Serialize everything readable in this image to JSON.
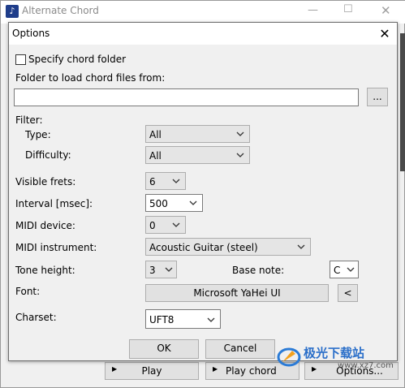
{
  "parent_window": {
    "title": "Alternate Chord",
    "buttons": {
      "play": "Play",
      "play_chord": "Play chord",
      "options": "Options..."
    }
  },
  "dialog": {
    "title": "Options",
    "specify_folder": {
      "label": "Specify chord folder",
      "checked": false
    },
    "folder_label": "Folder to load chord files from:",
    "folder_value": "",
    "browse_label": "...",
    "filter_label": "Filter:",
    "type": {
      "label": "Type:",
      "value": "All"
    },
    "difficulty": {
      "label": "Difficulty:",
      "value": "All"
    },
    "visible_frets": {
      "label": "Visible frets:",
      "value": "6"
    },
    "interval": {
      "label": "Interval [msec]:",
      "value": "500"
    },
    "midi_device": {
      "label": "MIDI device:",
      "value": "0"
    },
    "midi_instrument": {
      "label": "MIDI instrument:",
      "value": "Acoustic Guitar (steel)"
    },
    "tone_height": {
      "label": "Tone height:",
      "value": "3"
    },
    "base_note": {
      "label": "Base note:",
      "value": "C"
    },
    "font": {
      "label": "Font:",
      "value": "Microsoft YaHei UI",
      "button": "<"
    },
    "charset": {
      "label": "Charset:",
      "value": "UFT8"
    },
    "ok_label": "OK",
    "cancel_label": "Cancel"
  },
  "watermark": {
    "text": "极光下载站",
    "url": "www.xz7.com"
  }
}
